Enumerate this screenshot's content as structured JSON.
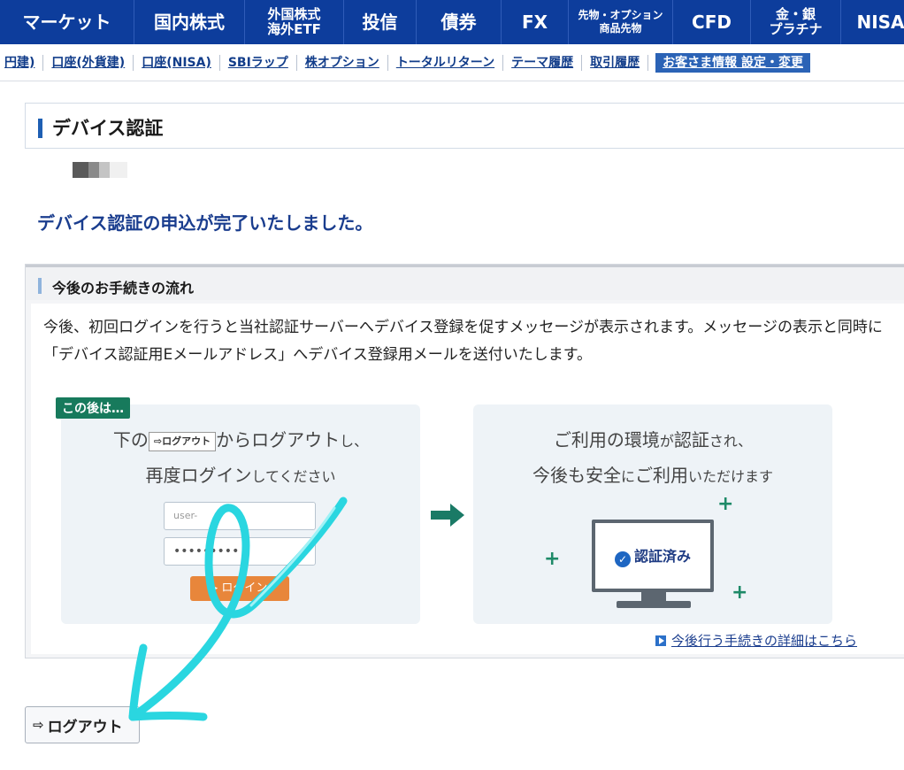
{
  "nav": {
    "items": [
      {
        "l1": "マーケット",
        "l2": ""
      },
      {
        "l1": "国内株式",
        "l2": ""
      },
      {
        "l1": "外国株式",
        "l2": "海外ETF"
      },
      {
        "l1": "投信",
        "l2": ""
      },
      {
        "l1": "債券",
        "l2": ""
      },
      {
        "l1": "FX",
        "l2": ""
      },
      {
        "l1": "先物・オプション",
        "l2": "商品先物"
      },
      {
        "l1": "CFD",
        "l2": ""
      },
      {
        "l1": "金・銀",
        "l2": "プラチナ"
      },
      {
        "l1": "NISA",
        "l2": ""
      }
    ]
  },
  "subnav": {
    "links": [
      "円建)",
      "口座(外貨建)",
      "口座(NISA)",
      "SBIラップ",
      "株オプション",
      "トータルリターン",
      "テーマ履歴",
      "取引履歴"
    ],
    "active": "お客さま情報 設定・変更"
  },
  "page": {
    "title": "デバイス認証",
    "complete_message": "デバイス認証の申込が完了いたしました。"
  },
  "procedure": {
    "title": "今後のお手続きの流れ",
    "description": "今後、初回ログインを行うと当社認証サーバーへデバイス登録を促すメッセージが表示されます。メッセージの表示と同時に「デバイス認証用Eメールアドレス」へデバイス登録用メールを送付いたします。",
    "after_badge": "この後は…",
    "step1": {
      "pre": "下の",
      "mini_button": "ログアウト",
      "mid": "からログアウト",
      "mid_small": "し、",
      "line2": "再度ログイン",
      "line2_small": "してください",
      "user_placeholder": "user-",
      "password_dots": "•••••••••",
      "login_label": "ログイン"
    },
    "step2": {
      "line1a": "ご利用の環境",
      "line1b": "が",
      "line1c": "認証",
      "line1d": "され、",
      "line2a": "今後も安全",
      "line2b": "に",
      "line2c": "ご利用",
      "line2d": "いただけます",
      "verified_label": "認証済み"
    },
    "detail_link": "今後行う手続きの詳細はこちら"
  },
  "logout": {
    "label": "ログアウト"
  }
}
